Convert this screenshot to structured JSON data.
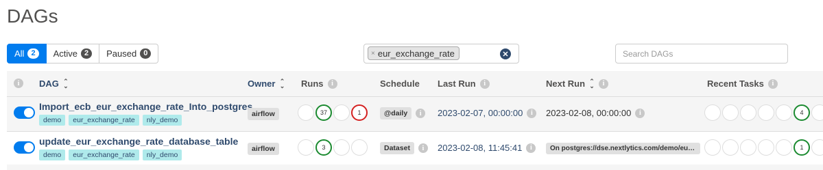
{
  "page": {
    "title": "DAGs"
  },
  "status_filter": {
    "buttons": [
      {
        "label": "All",
        "count": "2"
      },
      {
        "label": "Active",
        "count": "2"
      },
      {
        "label": "Paused",
        "count": "0"
      }
    ]
  },
  "tag_filter": {
    "chip": "eur_exchange_rate",
    "remove_glyph": "×",
    "clear_glyph": "✕"
  },
  "search": {
    "placeholder": "Search DAGs"
  },
  "table": {
    "headers": {
      "dag": "DAG",
      "owner": "Owner",
      "runs": "Runs",
      "schedule": "Schedule",
      "last_run": "Last Run",
      "next_run": "Next Run",
      "recent_tasks": "Recent Tasks"
    },
    "rows": [
      {
        "dag_id": "Import_ecb_eur_exchange_rate_Into_postgres",
        "paused": false,
        "tags": [
          "demo",
          "eur_exchange_rate",
          "nly_demo"
        ],
        "owner": "airflow",
        "runs": [
          "",
          "37",
          "",
          "1"
        ],
        "schedule": "@daily",
        "last_run": "2023-02-07, 00:00:00",
        "next_run": "2023-02-08, 00:00:00",
        "recent_tasks": [
          "",
          "",
          "",
          "",
          "",
          "4",
          ""
        ]
      },
      {
        "dag_id": "update_eur_exchange_rate_database_table",
        "paused": false,
        "tags": [
          "demo",
          "eur_exchange_rate",
          "nly_demo"
        ],
        "owner": "airflow",
        "runs": [
          "",
          "3",
          "",
          ""
        ],
        "schedule": "Dataset",
        "last_run": "2023-02-08, 11:45:41",
        "next_run": "On postgres://dse.nextlytics.com/demo/eur_exchange_rate",
        "recent_tasks": [
          "",
          "",
          "",
          "",
          "",
          "1",
          ""
        ]
      }
    ]
  },
  "icons": {
    "info": "info-icon",
    "sort": "sort-icon",
    "toggle": "toggle-switch"
  },
  "colors": {
    "accent": "#017cee",
    "link": "#2f4a6d",
    "tag_bg": "#afeaeb",
    "success": "#1a8a2f",
    "failed": "#d42020"
  }
}
